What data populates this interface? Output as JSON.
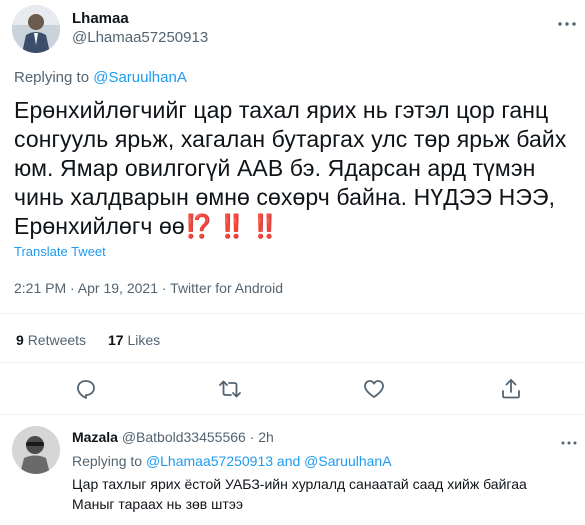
{
  "main_tweet": {
    "display_name": "Lhamaa",
    "handle": "@Lhamaa57250913",
    "replying_prefix": "Replying to",
    "replying_to": "@SaruulhanA",
    "text": "Ерөнхийлөгчийг цар тахал ярих нь гэтэл цор ганц сонгууль ярьж, хагалан бутаргах улс төр ярьж байх юм. Ямар овилгогүй ААВ бэ. Ядарсан ард түмэн чинь халдварын өмнө сөхөрч байна. НҮДЭЭ НЭЭ, Ерөнхийлөгч өө",
    "emojis": "⁉️ ‼️ ‼️",
    "translate_label": "Translate Tweet",
    "timestamp": "2:21 PM · Apr 19, 2021 · Twitter for Android",
    "retweets_count": "9",
    "retweets_label": "Retweets",
    "likes_count": "17",
    "likes_label": "Likes"
  },
  "actions": {
    "reply_icon": "reply-icon",
    "retweet_icon": "retweet-icon",
    "like_icon": "heart-icon",
    "share_icon": "share-icon"
  },
  "reply_tweet": {
    "display_name": "Mazala",
    "handle": "@Batbold33455566",
    "separator": "·",
    "time": "2h",
    "replying_prefix": "Replying to",
    "replying_to_1": "@Lhamaa57250913",
    "and_word": "and",
    "replying_to_2": "@SaruulhanA",
    "line1": "Цар тахлыг ярих ёстой УАБЗ-ийн хурлалд санаатай саад хийж байгаа",
    "line2": "Маныг тараах нь зөв штээ"
  },
  "colors": {
    "link": "#1d9bf0",
    "text": "#0f1419",
    "muted": "#536471",
    "emoji_red": "#be1931"
  }
}
